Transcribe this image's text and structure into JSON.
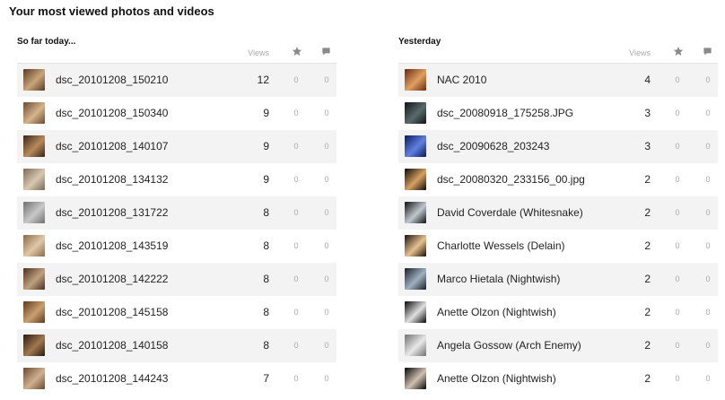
{
  "title": "Your most viewed photos and videos",
  "columns": {
    "views": "Views",
    "fav_icon": "star-icon",
    "comment_icon": "comment-bubble-icon"
  },
  "today": {
    "label": "So far today...",
    "items": [
      {
        "name": "dsc_20101208_150210",
        "views": "12",
        "favs": "0",
        "comments": "0",
        "thumb_colors": [
          "#5a3a22",
          "#c9a57a"
        ]
      },
      {
        "name": "dsc_20101208_150340",
        "views": "9",
        "favs": "0",
        "comments": "0",
        "thumb_colors": [
          "#6b4a30",
          "#d6b48c"
        ]
      },
      {
        "name": "dsc_20101208_140107",
        "views": "9",
        "favs": "0",
        "comments": "0",
        "thumb_colors": [
          "#3a2414",
          "#b78a5c"
        ]
      },
      {
        "name": "dsc_20101208_134132",
        "views": "9",
        "favs": "0",
        "comments": "0",
        "thumb_colors": [
          "#7a6a58",
          "#d8c8b0"
        ]
      },
      {
        "name": "dsc_20101208_131722",
        "views": "8",
        "favs": "0",
        "comments": "0",
        "thumb_colors": [
          "#707070",
          "#c8c8c8"
        ]
      },
      {
        "name": "dsc_20101208_143519",
        "views": "8",
        "favs": "0",
        "comments": "0",
        "thumb_colors": [
          "#8a6a4a",
          "#e0c8a8"
        ]
      },
      {
        "name": "dsc_20101208_142222",
        "views": "8",
        "favs": "0",
        "comments": "0",
        "thumb_colors": [
          "#4a3020",
          "#c0a080"
        ]
      },
      {
        "name": "dsc_20101208_145158",
        "views": "8",
        "favs": "0",
        "comments": "0",
        "thumb_colors": [
          "#5c3a1c",
          "#caa070"
        ]
      },
      {
        "name": "dsc_20101208_140158",
        "views": "8",
        "favs": "0",
        "comments": "0",
        "thumb_colors": [
          "#2a1a10",
          "#a07850"
        ]
      },
      {
        "name": "dsc_20101208_144243",
        "views": "7",
        "favs": "0",
        "comments": "0",
        "thumb_colors": [
          "#6a4a30",
          "#d0b090"
        ]
      }
    ]
  },
  "yesterday": {
    "label": "Yesterday",
    "items": [
      {
        "name": "NAC 2010",
        "views": "4",
        "favs": "0",
        "comments": "0",
        "thumb_colors": [
          "#6a2a10",
          "#e0a060"
        ]
      },
      {
        "name": "dsc_20080918_175258.JPG",
        "views": "3",
        "favs": "0",
        "comments": "0",
        "thumb_colors": [
          "#101418",
          "#5a6a6a"
        ]
      },
      {
        "name": "dsc_20090628_203243",
        "views": "3",
        "favs": "0",
        "comments": "0",
        "thumb_colors": [
          "#0a1a5a",
          "#6080e0"
        ]
      },
      {
        "name": "dsc_20080320_233156_00.jpg",
        "views": "2",
        "favs": "0",
        "comments": "0",
        "thumb_colors": [
          "#0a0a0a",
          "#d8a060"
        ]
      },
      {
        "name": "David Coverdale (Whitesnake)",
        "views": "2",
        "favs": "0",
        "comments": "0",
        "thumb_colors": [
          "#101010",
          "#c0c8d0"
        ]
      },
      {
        "name": "Charlotte Wessels (Delain)",
        "views": "2",
        "favs": "0",
        "comments": "0",
        "thumb_colors": [
          "#1a1008",
          "#e8c090"
        ]
      },
      {
        "name": "Marco Hietala (Nightwish)",
        "views": "2",
        "favs": "0",
        "comments": "0",
        "thumb_colors": [
          "#18202a",
          "#a0b0c0"
        ]
      },
      {
        "name": "Anette Olzon (Nightwish)",
        "views": "2",
        "favs": "0",
        "comments": "0",
        "thumb_colors": [
          "#080808",
          "#e0e0e0"
        ]
      },
      {
        "name": "Angela Gossow (Arch Enemy)",
        "views": "2",
        "favs": "0",
        "comments": "0",
        "thumb_colors": [
          "#707070",
          "#e8e8e8"
        ]
      },
      {
        "name": "Anette Olzon (Nightwish)",
        "views": "2",
        "favs": "0",
        "comments": "0",
        "thumb_colors": [
          "#050505",
          "#d0c0b0"
        ]
      }
    ]
  }
}
